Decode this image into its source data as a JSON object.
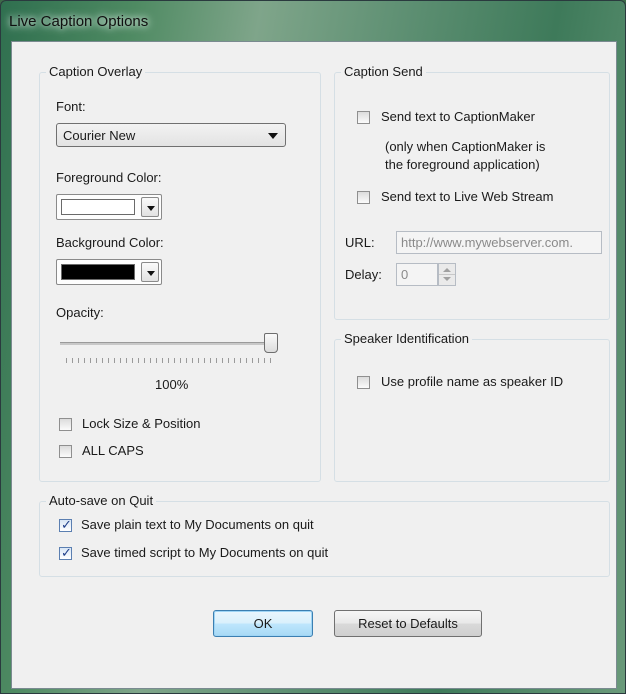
{
  "window": {
    "title": "Live Caption Options"
  },
  "caption_overlay": {
    "group_label": "Caption Overlay",
    "font_label": "Font:",
    "font_value": "Courier New",
    "foreground_label": "Foreground Color:",
    "foreground_color": "#ffffff",
    "background_label": "Background Color:",
    "background_color": "#000000",
    "opacity_label": "Opacity:",
    "opacity_value": "100%",
    "lock_label": "Lock Size & Position",
    "lock_checked": false,
    "allcaps_label": "ALL CAPS",
    "allcaps_checked": false
  },
  "caption_send": {
    "group_label": "Caption Send",
    "send_captionmaker_label": "Send text to CaptionMaker",
    "send_captionmaker_checked": false,
    "note_line1": "(only when CaptionMaker is",
    "note_line2": "the foreground application)",
    "send_web_label": "Send text to Live Web Stream",
    "send_web_checked": false,
    "url_label": "URL:",
    "url_value": "http://www.mywebserver.com.",
    "delay_label": "Delay:",
    "delay_value": "0"
  },
  "speaker": {
    "group_label": "Speaker Identification",
    "profile_label": "Use profile name as speaker ID",
    "profile_checked": false
  },
  "autosave": {
    "group_label": "Auto-save on Quit",
    "plain_label": "Save plain text to My Documents on quit",
    "plain_checked": true,
    "timed_label": "Save timed script to My Documents on quit",
    "timed_checked": true
  },
  "buttons": {
    "ok": "OK",
    "reset": "Reset to Defaults"
  }
}
